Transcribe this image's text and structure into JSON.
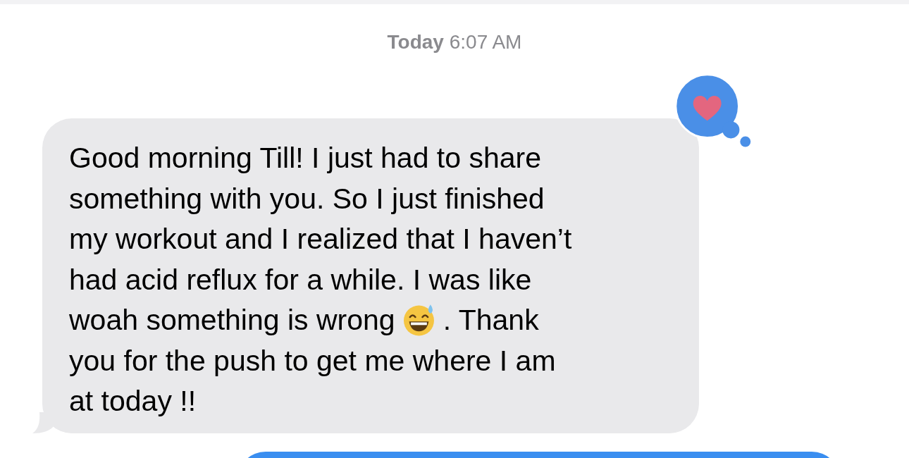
{
  "timestamp": "**Today** 6:07 AM",
  "message": {
    "lines": [
      {
        "kind": "text",
        "text": "Good morning Till! I just had to share"
      },
      {
        "kind": "text",
        "text": "something with you. So I just finished"
      },
      {
        "kind": "text",
        "text": "my workout and I realized that I haven’t"
      },
      {
        "kind": "text",
        "text": "had acid reflux for a while. I was like"
      },
      {
        "kind": "emoji",
        "text_before": "woah something is wrong",
        "text_after": ". Thank"
      },
      {
        "kind": "text",
        "text": "you for the push to get me where I am"
      },
      {
        "kind": "text",
        "text": "at today !!"
      }
    ]
  }
}
